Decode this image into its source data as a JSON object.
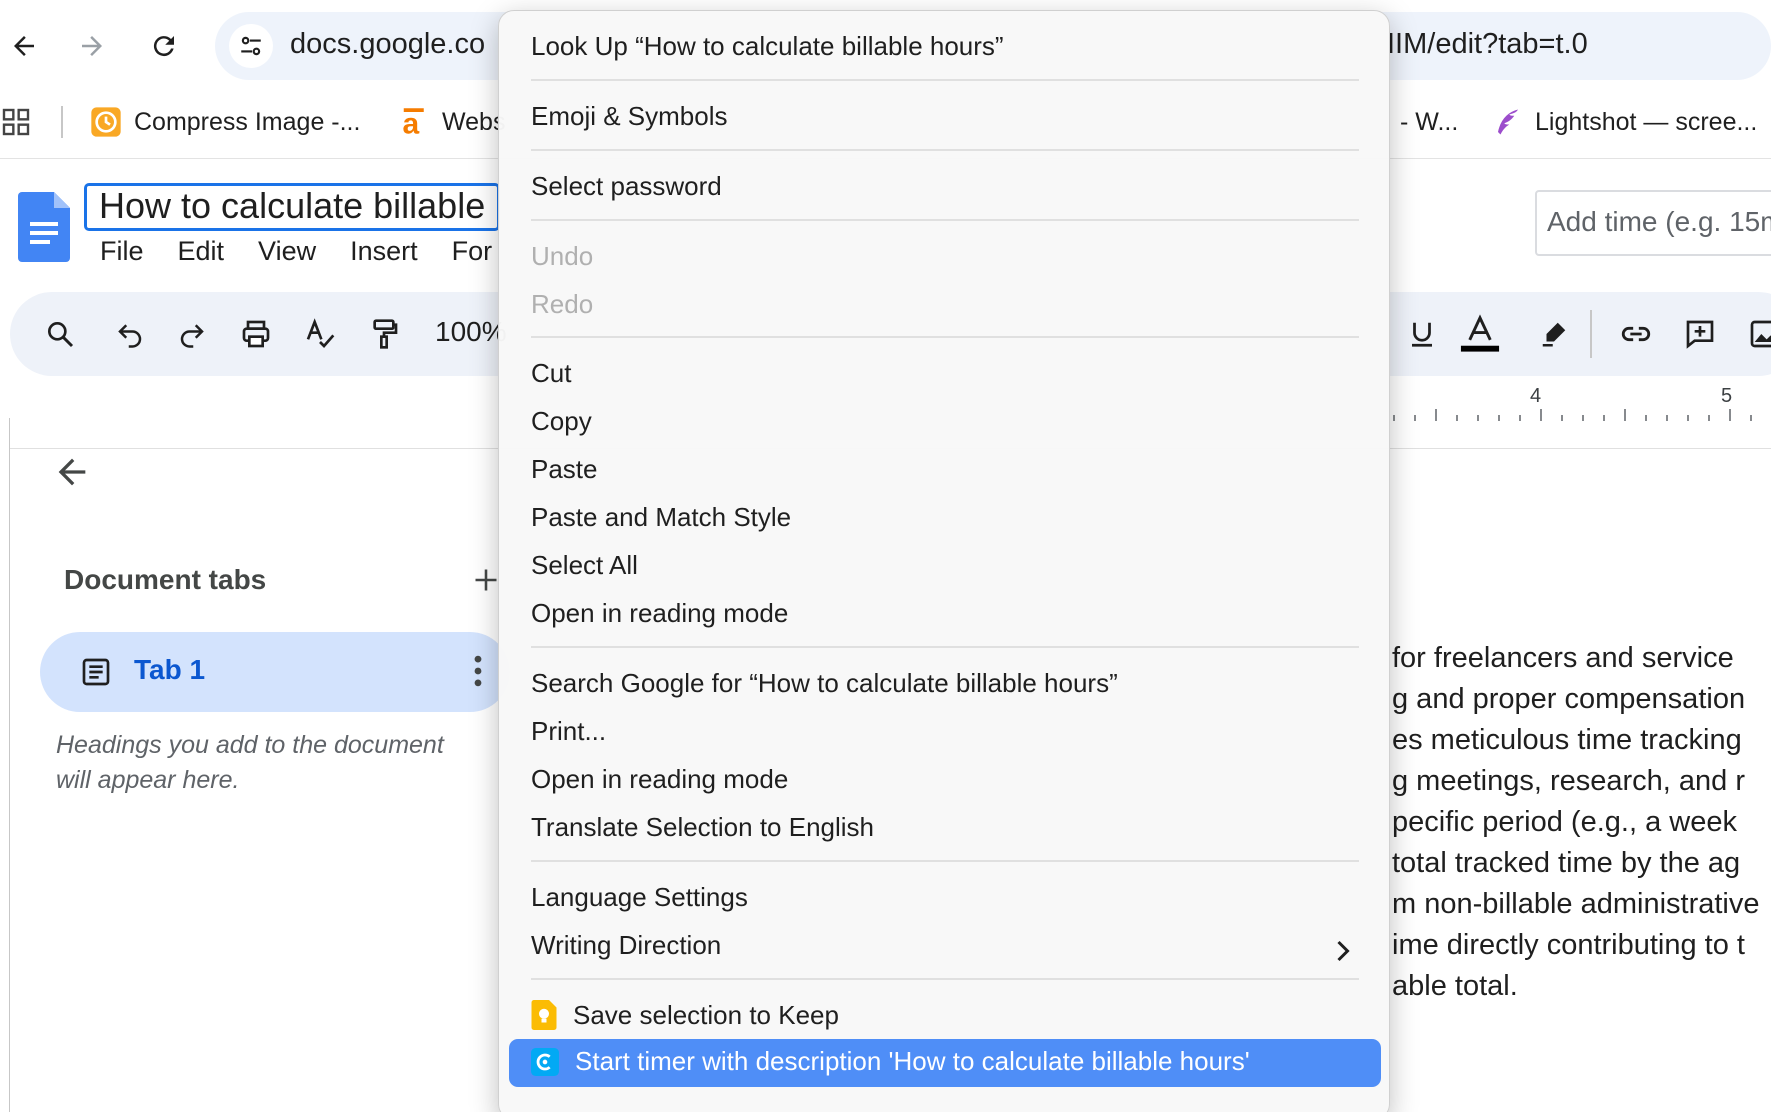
{
  "browser": {
    "url_left": "docs.google.co",
    "url_right": "IIM/edit?tab=t.0"
  },
  "bookmarks": {
    "items": [
      {
        "label": "Compress Image -..."
      },
      {
        "label": "Webs"
      },
      {
        "label": "- W..."
      },
      {
        "label": "Lightshot — scree..."
      }
    ]
  },
  "docs": {
    "title": "How to calculate billable",
    "menu": [
      "File",
      "Edit",
      "View",
      "Insert",
      "For"
    ],
    "add_time_placeholder": "Add time (e.g. 15m",
    "zoom": "100%"
  },
  "ruler": {
    "mark_a": "4",
    "mark_b": "5"
  },
  "tabs_panel": {
    "heading": "Document tabs",
    "tab_label": "Tab 1",
    "hint": "Headings you add to the document will appear here."
  },
  "document": {
    "lines": [
      "for freelancers and service",
      "g and proper compensation",
      "es meticulous time tracking",
      "g meetings, research, and r",
      "pecific period (e.g., a week",
      "total tracked time by the ag",
      "m non-billable administrative",
      "ime directly contributing to t",
      "able total."
    ]
  },
  "context_menu": {
    "look_up": "Look Up “How to calculate billable hours”",
    "emoji": "Emoji & Symbols",
    "select_password": "Select password",
    "undo": "Undo",
    "redo": "Redo",
    "cut": "Cut",
    "copy": "Copy",
    "paste": "Paste",
    "paste_match": "Paste and Match Style",
    "select_all": "Select All",
    "reading_mode_1": "Open in reading mode",
    "search_google": "Search Google for “How to calculate billable hours”",
    "print": "Print...",
    "reading_mode_2": "Open in reading mode",
    "translate": "Translate Selection to English",
    "language_settings": "Language Settings",
    "writing_direction": "Writing Direction",
    "save_keep": "Save selection to Keep",
    "start_timer": "Start timer with description 'How to calculate billable hours'"
  },
  "colors": {
    "accent": "#1a73e8",
    "menu_highlight": "#4f8ef7",
    "tab_pill": "#d3e3fd",
    "keep_yellow": "#fbbc04",
    "clockify_blue": "#03a9f4"
  }
}
